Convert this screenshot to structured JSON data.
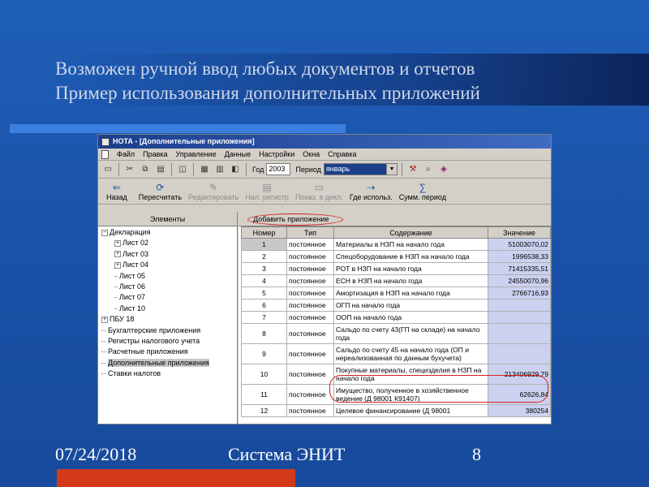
{
  "slide": {
    "title_line1": "Возможен ручной ввод любых документов и отчетов",
    "title_line2": "Пример использования дополнительных приложений",
    "footer_date": "07/24/2018",
    "footer_system": "Система ЭНИТ",
    "footer_page": "8"
  },
  "window": {
    "title": "НОТА - [Дополнительные приложения]",
    "menu": [
      "Файл",
      "Правка",
      "Управление",
      "Данные",
      "Настройки",
      "Окна",
      "Справка"
    ],
    "year_label": "Год",
    "year_value": "2003",
    "period_label": "Период",
    "period_value": "январь"
  },
  "toolbar2": [
    {
      "label": "Назад",
      "icon": "arrow-left-icon",
      "enabled": true
    },
    {
      "label": "Пересчитать",
      "icon": "recalculate-icon",
      "enabled": true
    },
    {
      "label": "Редактировать",
      "icon": "edit-icon",
      "enabled": false
    },
    {
      "label": "Нал. регистр",
      "icon": "tax-register-icon",
      "enabled": false
    },
    {
      "label": "Показ. в декл.",
      "icon": "show-in-declaration-icon",
      "enabled": false
    },
    {
      "label": "Где использ.",
      "icon": "where-used-icon",
      "enabled": true
    },
    {
      "label": "Сумм. период",
      "icon": "sum-period-icon",
      "enabled": true
    }
  ],
  "left_pane": {
    "header": "Элементы",
    "tree": [
      {
        "label": "Декларация",
        "level": 0,
        "toggle": "−"
      },
      {
        "label": "Лист 02",
        "level": 1,
        "toggle": "+"
      },
      {
        "label": "Лист 03",
        "level": 1,
        "toggle": "+"
      },
      {
        "label": "Лист 04",
        "level": 1,
        "toggle": "+"
      },
      {
        "label": "Лист 05",
        "level": 1,
        "toggle": ""
      },
      {
        "label": "Лист 06",
        "level": 1,
        "toggle": ""
      },
      {
        "label": "Лист 07",
        "level": 1,
        "toggle": ""
      },
      {
        "label": "Лист 10",
        "level": 1,
        "toggle": ""
      },
      {
        "label": "ПБУ 18",
        "level": 0,
        "toggle": "+"
      },
      {
        "label": "Бухгалтерские приложения",
        "level": 0,
        "toggle": ""
      },
      {
        "label": "Регистры налогового учета",
        "level": 0,
        "toggle": ""
      },
      {
        "label": "Расчетные приложения",
        "level": 0,
        "toggle": ""
      },
      {
        "label": "Дополнительные приложения",
        "level": 0,
        "toggle": "",
        "selected": true
      },
      {
        "label": "Ставки налогов",
        "level": 0,
        "toggle": ""
      }
    ]
  },
  "right_pane": {
    "add_button": "Добавить приложение",
    "columns": [
      "Номер",
      "Тип",
      "Содержание",
      "Значение"
    ],
    "rows": [
      {
        "num": "1",
        "type": "постоянное",
        "content": "Материалы в НЗП на начало года",
        "value": "51003070,02"
      },
      {
        "num": "2",
        "type": "постоянное",
        "content": "Спецоборудование в НЗП на начало года",
        "value": "1996538,33"
      },
      {
        "num": "3",
        "type": "постоянное",
        "content": "РОТ в НЗП на начало года",
        "value": "71415335,51"
      },
      {
        "num": "4",
        "type": "постоянное",
        "content": "ЕСН в НЗП на начало года",
        "value": "24550070,96"
      },
      {
        "num": "5",
        "type": "постоянное",
        "content": "Амортизация в НЗП на начало года",
        "value": "2766716,93"
      },
      {
        "num": "6",
        "type": "постоянное",
        "content": "ОГП на начало года",
        "value": ""
      },
      {
        "num": "7",
        "type": "постоянное",
        "content": "ООП на начало года",
        "value": ""
      },
      {
        "num": "8",
        "type": "постоянное",
        "content": "Сальдо по счету 43(ГП на складе) на начало года",
        "value": ""
      },
      {
        "num": "9",
        "type": "постоянное",
        "content": "Сальдо по счету 45 на начало года (ОП и нереализованная по данным бухучета)",
        "value": ""
      },
      {
        "num": "10",
        "type": "постоянное",
        "content": "Покупные материалы, специзделия в НЗП на начало года",
        "value": "213406929,79"
      },
      {
        "num": "11",
        "type": "постоянное",
        "content": "Имущество, полученное в хозяйственное ведение (Д 98001 К91407)",
        "value": "62626,84"
      },
      {
        "num": "12",
        "type": "постоянное",
        "content": "Целевое финансирование (Д 98001",
        "value": "380254"
      }
    ]
  }
}
